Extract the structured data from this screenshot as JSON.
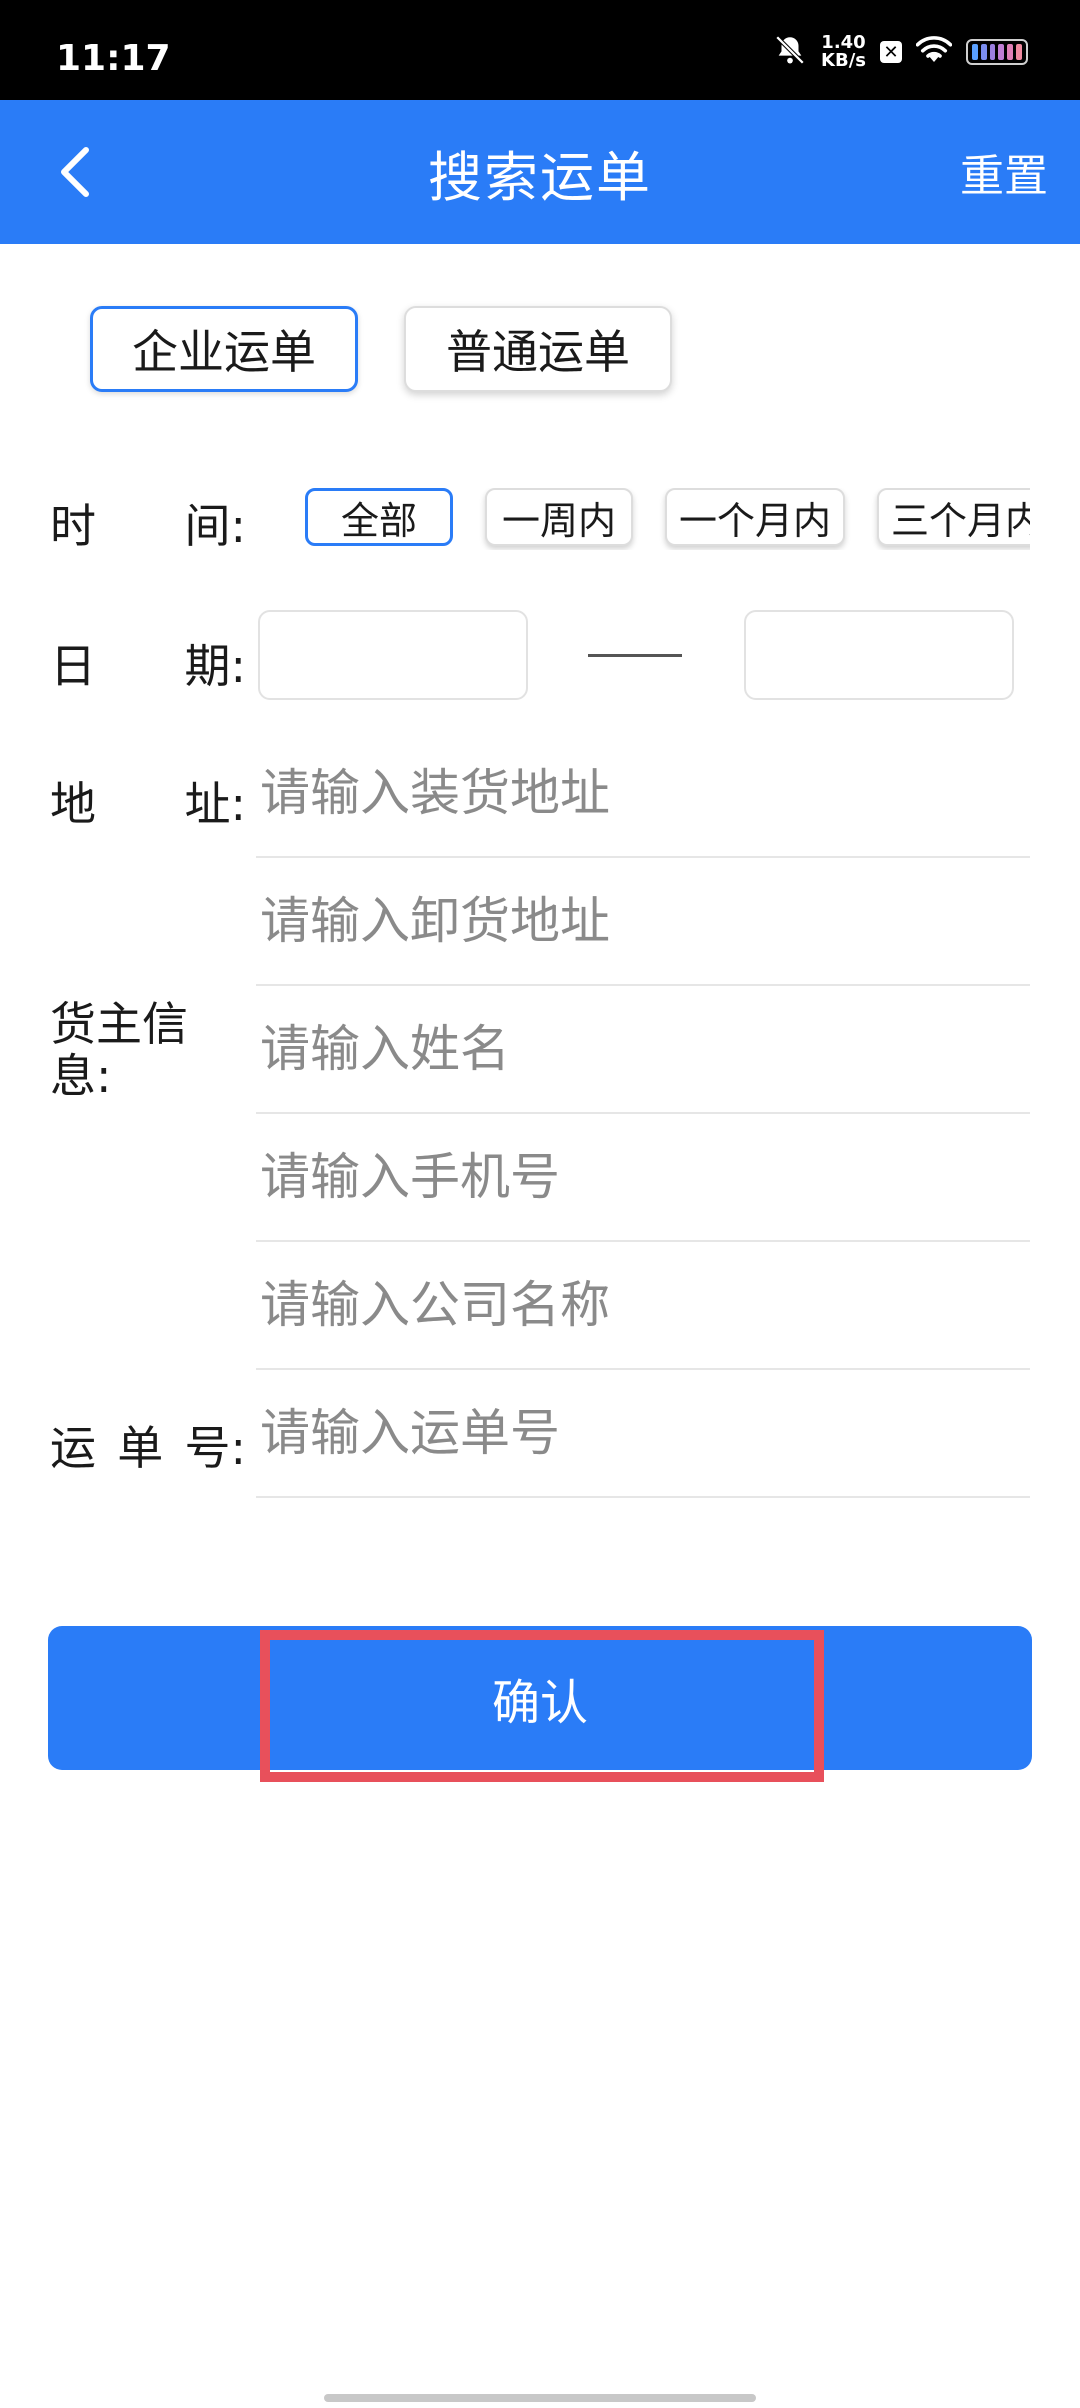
{
  "status_bar": {
    "time": "11:17",
    "net_speed_value": "1.40",
    "net_speed_unit": "KB/s",
    "badge": "✕",
    "icons": [
      "bell-off-icon",
      "close-badge-icon",
      "wifi-icon",
      "battery-icon"
    ]
  },
  "header": {
    "title": "搜索运单",
    "back_icon": "chevron-left-icon",
    "reset_label": "重置"
  },
  "type_tabs": [
    {
      "label": "企业运单",
      "selected": true
    },
    {
      "label": "普通运单",
      "selected": false
    }
  ],
  "filters": {
    "time_label": [
      "时",
      "间:"
    ],
    "time_options": [
      {
        "label": "全部",
        "selected": true
      },
      {
        "label": "一周内",
        "selected": false
      },
      {
        "label": "一个月内",
        "selected": false
      },
      {
        "label": "三个月内",
        "selected": false
      }
    ],
    "date_label": [
      "日",
      "期:"
    ],
    "date_start": "",
    "date_end": "",
    "address_label": [
      "地",
      "址:"
    ],
    "load_address_placeholder": "请输入装货地址",
    "unload_address_placeholder": "请输入卸货地址",
    "shipper_label": "货主信息:",
    "name_placeholder": "请输入姓名",
    "phone_placeholder": "请输入手机号",
    "company_placeholder": "请输入公司名称",
    "waybill_label": [
      "运",
      "单",
      "号:"
    ],
    "waybill_placeholder": "请输入运单号"
  },
  "confirm_label": "确认",
  "colors": {
    "primary": "#2a7cf7",
    "highlight": "#e8505b",
    "placeholder": "#8a8a8a"
  }
}
